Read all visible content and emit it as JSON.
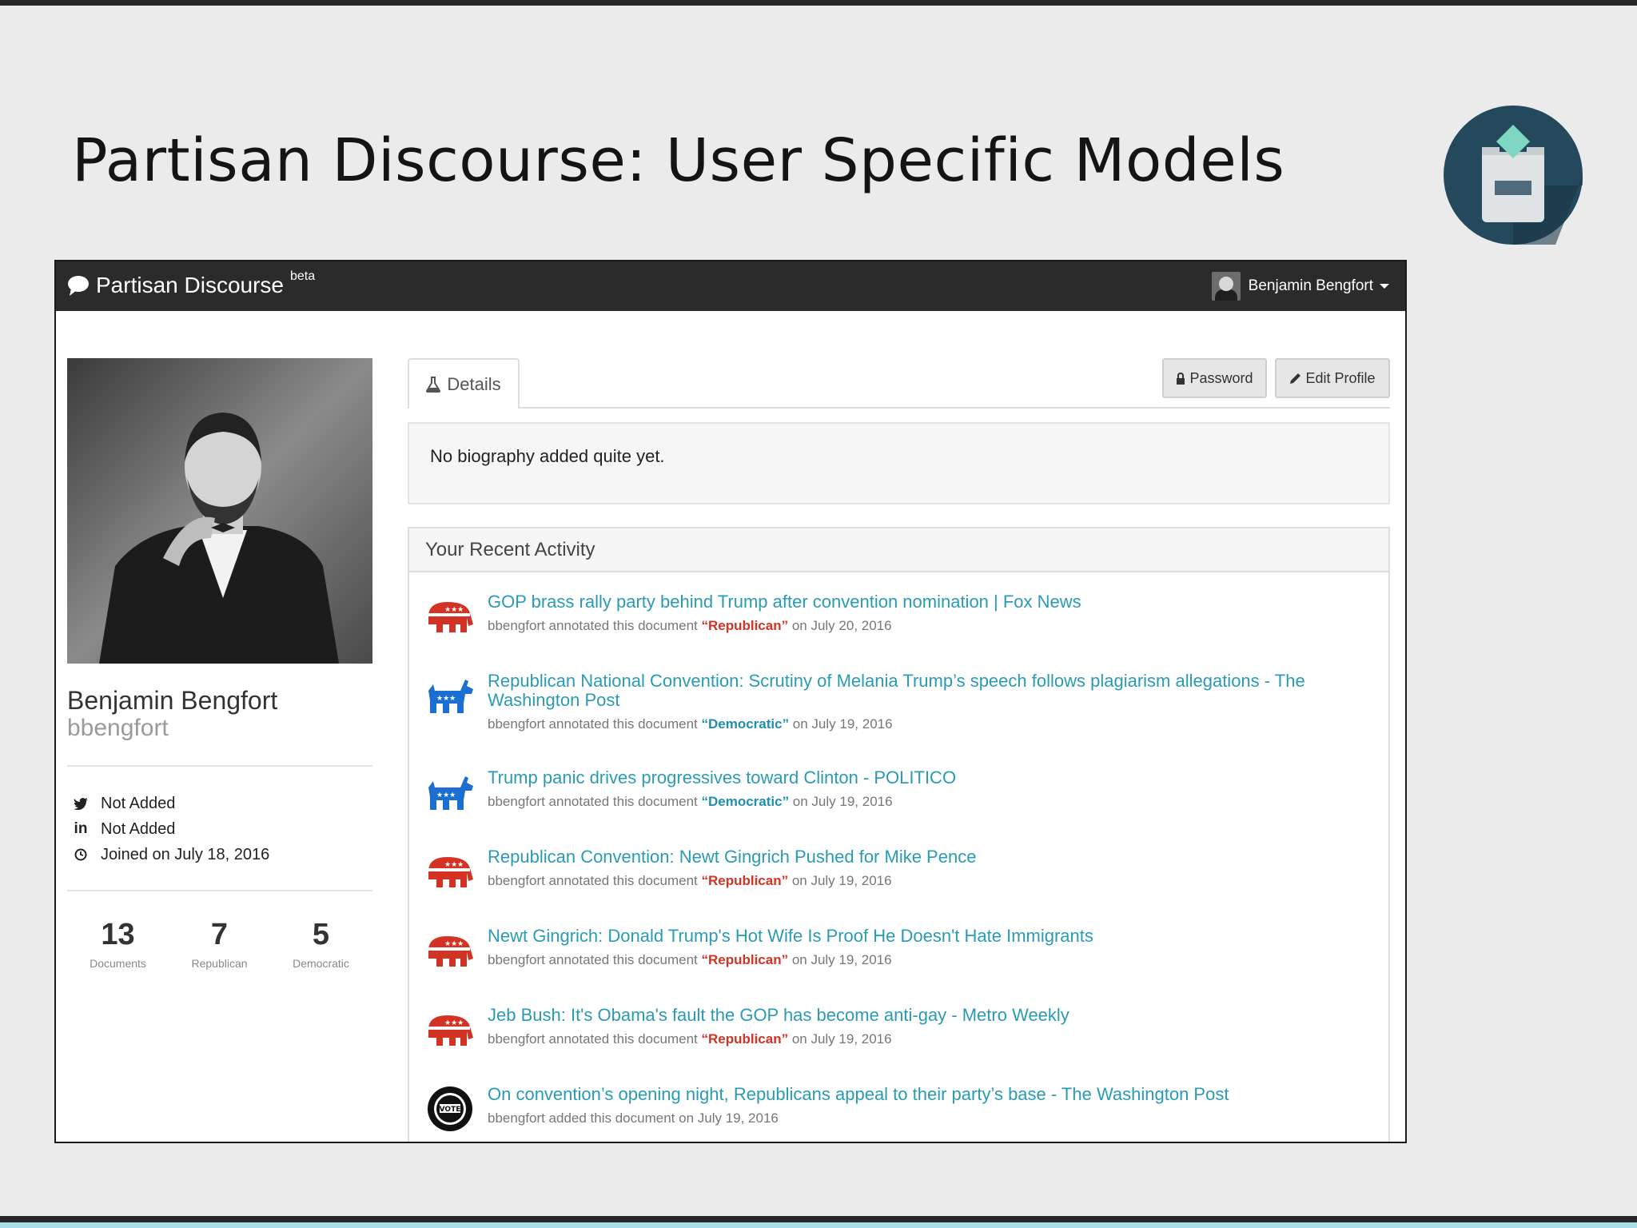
{
  "slide": {
    "title": "Partisan Discourse: User Specific Models"
  },
  "navbar": {
    "brand": "Partisan Discourse",
    "brand_sup": "beta",
    "user_name": "Benjamin Bengfort"
  },
  "profile": {
    "name": "Benjamin Bengfort",
    "username": "bbengfort",
    "twitter": "Not Added",
    "linkedin": "Not Added",
    "joined": "Joined on July 18, 2016",
    "stats": [
      {
        "value": "13",
        "label": "Documents"
      },
      {
        "value": "7",
        "label": "Republican"
      },
      {
        "value": "5",
        "label": "Democratic"
      }
    ]
  },
  "details": {
    "tab_label": "Details",
    "password_label": "Password",
    "edit_profile_label": "Edit Profile",
    "bio": "No biography added quite yet."
  },
  "activity": {
    "heading": "Your Recent Activity",
    "items": [
      {
        "title": "GOP brass rally party behind Trump after convention nomination | Fox News",
        "meta_prefix": "bbengfort annotated this document ",
        "party_label": "“Republican”",
        "meta_suffix": " on July 20, 2016",
        "icon": "republican-elephant-icon"
      },
      {
        "title": "Republican National Convention: Scrutiny of Melania Trump’s speech follows plagiarism allegations - The Washington Post",
        "meta_prefix": "bbengfort annotated this document ",
        "party_label": "“Democratic”",
        "meta_suffix": " on July 19, 2016",
        "icon": "democratic-donkey-icon"
      },
      {
        "title": "Trump panic drives progressives toward Clinton - POLITICO",
        "meta_prefix": "bbengfort annotated this document ",
        "party_label": "“Democratic”",
        "meta_suffix": " on July 19, 2016",
        "icon": "democratic-donkey-icon"
      },
      {
        "title": "Republican Convention: Newt Gingrich Pushed for Mike Pence",
        "meta_prefix": "bbengfort annotated this document ",
        "party_label": "“Republican”",
        "meta_suffix": " on July 19, 2016",
        "icon": "republican-elephant-icon"
      },
      {
        "title": "Newt Gingrich: Donald Trump's Hot Wife Is Proof He Doesn't Hate Immigrants",
        "meta_prefix": "bbengfort annotated this document ",
        "party_label": "“Republican”",
        "meta_suffix": " on July 19, 2016",
        "icon": "republican-elephant-icon"
      },
      {
        "title": "Jeb Bush: It's Obama's fault the GOP has become anti-gay - Metro Weekly",
        "meta_prefix": "bbengfort annotated this document ",
        "party_label": "“Republican”",
        "meta_suffix": " on July 19, 2016",
        "icon": "republican-elephant-icon"
      },
      {
        "title": "On convention’s opening night, Republicans appeal to their party’s base - The Washington Post",
        "meta_prefix": "bbengfort added this document on July 19, 2016",
        "party_label": "",
        "meta_suffix": "",
        "icon": "vote-badge-icon"
      }
    ]
  },
  "colors": {
    "republican": "#d33324",
    "democratic": "#1d8fb0",
    "link": "#2a9bb4",
    "navbar": "#2b2b2b"
  }
}
